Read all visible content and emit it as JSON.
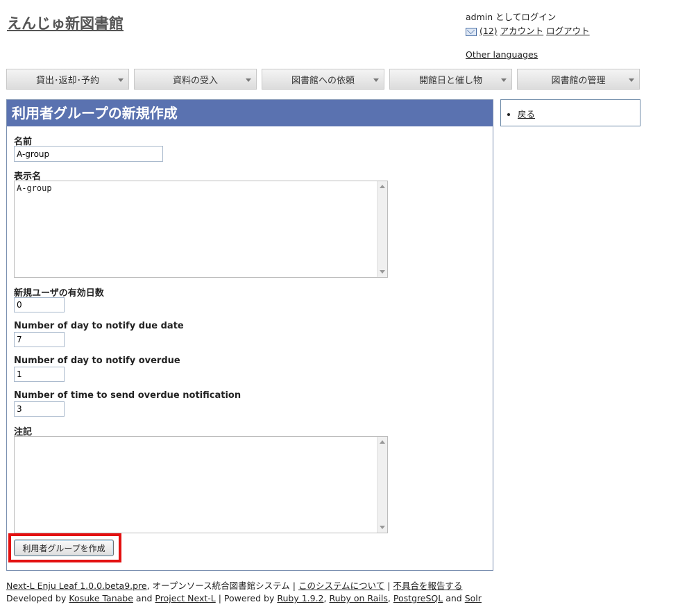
{
  "header": {
    "site_title": "えんじゅ新図書館",
    "login_status": "admin としてログイン",
    "mail_count": "(12)",
    "account_link": "アカウント",
    "logout_link": "ログアウト",
    "other_languages": "Other languages"
  },
  "nav": {
    "tabs": [
      {
        "label": "貸出･返却･予約"
      },
      {
        "label": "資料の受入"
      },
      {
        "label": "図書館への依頼"
      },
      {
        "label": "開館日と催し物"
      },
      {
        "label": "図書館の管理"
      }
    ]
  },
  "form": {
    "heading": "利用者グループの新規作成",
    "name_label": "名前",
    "name_value": "A-group",
    "display_name_label": "表示名",
    "display_name_value": "A-group",
    "valid_days_label": "新規ユーザの有効日数",
    "valid_days_value": "0",
    "due_notify_label": "Number of day to notify due date",
    "due_notify_value": "7",
    "overdue_notify_label": "Number of day to notify overdue",
    "overdue_notify_value": "1",
    "overdue_times_label": "Number of time to send overdue notification",
    "overdue_times_value": "3",
    "note_label": "注記",
    "note_value": "",
    "submit_label": "利用者グループを作成"
  },
  "sidebar": {
    "back_link": "戻る"
  },
  "footer": {
    "product_link": "Next-L Enju Leaf 1.0.0.beta9.pre",
    "product_desc": ", オープンソース統合図書館システム",
    "sep1": " | ",
    "about_link": "このシステムについて",
    "sep2": " | ",
    "report_link": "不具合を報告する",
    "developed_by": "Developed by ",
    "dev_name_link": "Kosuke Tanabe",
    "and1": " and ",
    "project_link": "Project Next-L",
    "powered_by": " | Powered by ",
    "ruby_link": "Ruby 1.9.2",
    "comma1": ", ",
    "rails_link": "Ruby on Rails",
    "comma2": ", ",
    "pg_link": "PostgreSQL",
    "and2": " and ",
    "solr_link": "Solr"
  },
  "colors": {
    "panel_header": "#5a72b0",
    "highlight": "#e31010"
  }
}
